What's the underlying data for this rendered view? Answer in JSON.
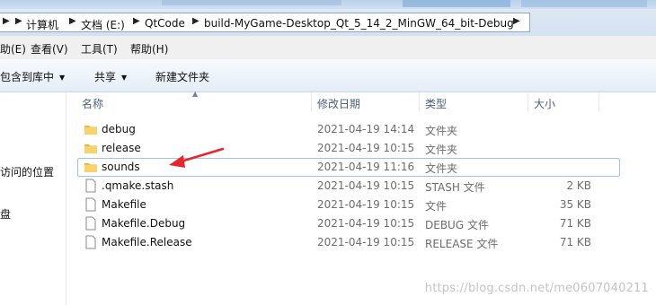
{
  "address": {
    "crumbs": [
      "计算机",
      "文档 (E:)",
      "QtCode",
      "build-MyGame-Desktop_Qt_5_14_2_MinGW_64_bit-Debug"
    ]
  },
  "menu": {
    "items": [
      "助(E)",
      "查看(V)",
      "工具(T)",
      "帮助(H)"
    ]
  },
  "toolbar": {
    "include_label": "包含到库中",
    "share_label": "共享",
    "new_folder_label": "新建文件夹"
  },
  "nav": {
    "items": [
      "访问的位置",
      "盘"
    ]
  },
  "columns": {
    "name": "名称",
    "date": "修改日期",
    "type": "类型",
    "size": "大小"
  },
  "files": [
    {
      "name": "debug",
      "date": "2021-04-19 14:14",
      "type": "文件夹",
      "size": "",
      "icon": "folder-icon"
    },
    {
      "name": "release",
      "date": "2021-04-19 10:15",
      "type": "文件夹",
      "size": "",
      "icon": "folder-icon"
    },
    {
      "name": "sounds",
      "date": "2021-04-19 11:16",
      "type": "文件夹",
      "size": "",
      "icon": "folder-icon"
    },
    {
      "name": ".qmake.stash",
      "date": "2021-04-19 10:15",
      "type": "STASH 文件",
      "size": "2 KB",
      "icon": "file-icon"
    },
    {
      "name": "Makefile",
      "date": "2021-04-19 10:15",
      "type": "文件",
      "size": "35 KB",
      "icon": "file-icon"
    },
    {
      "name": "Makefile.Debug",
      "date": "2021-04-19 10:15",
      "type": "DEBUG 文件",
      "size": "71 KB",
      "icon": "file-icon"
    },
    {
      "name": "Makefile.Release",
      "date": "2021-04-19 10:15",
      "type": "RELEASE 文件",
      "size": "71 KB",
      "icon": "file-icon"
    }
  ],
  "watermark": "https://blog.csdn.net/me0607040211",
  "colors": {
    "annotation_arrow": "#e8242c",
    "selection_border": "#9dc3e6",
    "folder": "#f0c64a"
  }
}
